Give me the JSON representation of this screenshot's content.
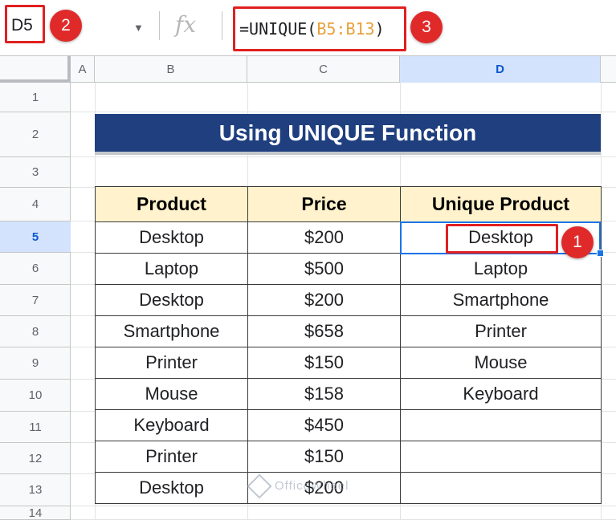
{
  "name_box": {
    "value": "D5"
  },
  "formula_bar": {
    "fx_label": "fx",
    "formula_prefix": "=UNIQUE(",
    "formula_range": "B5:B13",
    "formula_suffix": ")"
  },
  "callouts": {
    "cell": "1",
    "name_box": "2",
    "formula": "3"
  },
  "column_headers": [
    "A",
    "B",
    "C",
    "D"
  ],
  "active_column": "D",
  "row_numbers": [
    "1",
    "2",
    "3",
    "4",
    "5",
    "6",
    "7",
    "8",
    "9",
    "10",
    "11",
    "12",
    "13",
    "14"
  ],
  "active_row": "5",
  "title": "Using UNIQUE Function",
  "table": {
    "headers": [
      "Product",
      "Price",
      "Unique Product"
    ],
    "rows": [
      [
        "Desktop",
        "$200",
        "Desktop"
      ],
      [
        "Laptop",
        "$500",
        "Laptop"
      ],
      [
        "Desktop",
        "$200",
        "Smartphone"
      ],
      [
        "Smartphone",
        "$658",
        "Printer"
      ],
      [
        "Printer",
        "$150",
        "Mouse"
      ],
      [
        "Mouse",
        "$158",
        "Keyboard"
      ],
      [
        "Keyboard",
        "$450",
        ""
      ],
      [
        "Printer",
        "$150",
        ""
      ],
      [
        "Desktop",
        "$200",
        ""
      ]
    ]
  },
  "watermark": "OfficeWheel",
  "icons": {
    "name_box_dropdown": "chevron-down-icon",
    "formula": "fx-icon",
    "watermark_logo": "diamond-logo-icon"
  },
  "colors": {
    "title_bg": "#1f3f7f",
    "header_bg": "#fff2cc",
    "selection": "#1a73e8",
    "callout": "#e02020",
    "range_ref": "#e8a13a"
  }
}
